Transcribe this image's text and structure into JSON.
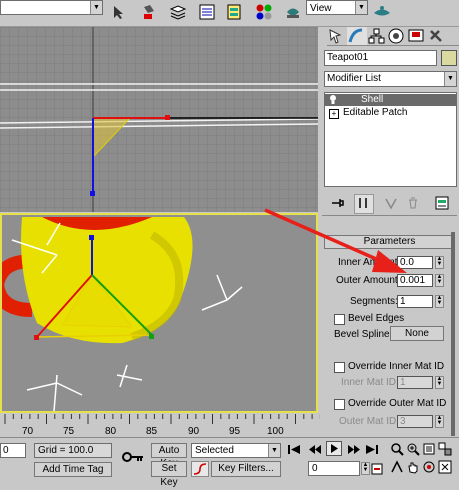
{
  "toolbar": {
    "view_label": "View",
    "icons": [
      "select-link-icon",
      "unlink-icon",
      "bind-space-warp-icon",
      "named-selection-icon",
      "mirror-icon",
      "align-icon",
      "layer-manager-icon",
      "curve-editor-icon",
      "material-editor-icon",
      "render-setup-icon",
      "render-icon"
    ]
  },
  "panel": {
    "tabs": [
      "create-tab",
      "modify-tab",
      "hierarchy-tab",
      "motion-tab",
      "display-tab",
      "utilities-tab"
    ],
    "object_name": "Teapot01",
    "object_color": "#d9d9a0",
    "modifier_list_label": "Modifier List",
    "stack": [
      "Shell",
      "Editable Patch"
    ],
    "rollout_title": "Parameters",
    "inner_amount_label": "Inner Amount:",
    "inner_amount_value": "0.0",
    "outer_amount_label": "Outer Amount:",
    "outer_amount_value": "0.001",
    "segments_label": "Segments:",
    "segments_value": "1",
    "bevel_edges_label": "Bevel Edges",
    "bevel_spline_label": "Bevel Spline:",
    "bevel_spline_button": "None",
    "override_inner_label": "Override Inner Mat ID",
    "inner_mat_label": "Inner Mat ID:",
    "inner_mat_value": "1",
    "override_outer_label": "Override Outer Mat ID",
    "outer_mat_label": "Outer Mat ID:",
    "outer_mat_value": "3"
  },
  "timeline": {
    "ticks": [
      "70",
      "75",
      "80",
      "85",
      "90",
      "95",
      "100"
    ]
  },
  "bottom": {
    "field0": "0",
    "grid_label": "Grid = 100.0",
    "add_time_tag": "Add Time Tag",
    "auto_key": "Auto Key",
    "set_key": "Set Key",
    "selected_option": "Selected",
    "key_filters": "Key Filters...",
    "frame_value": "0"
  },
  "colors": {
    "viewport_bg": "#8d8d8d",
    "teapot_yellow": "#e8e000",
    "teapot_red": "#e82000",
    "active_viewport_border": "#e5e04c"
  }
}
